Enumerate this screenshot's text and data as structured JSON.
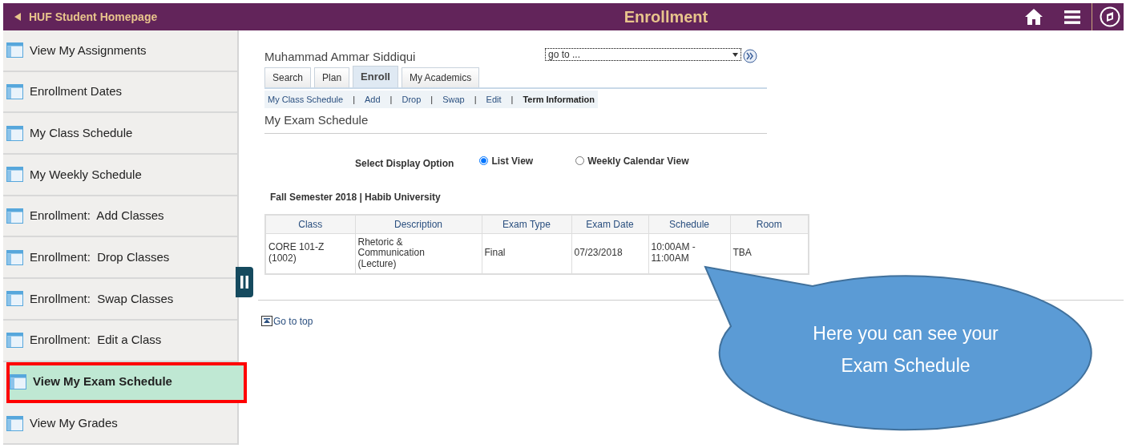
{
  "header": {
    "back_link": "HUF Student Homepage",
    "title": "Enrollment"
  },
  "sidebar": {
    "items": [
      {
        "label": "View My Assignments",
        "selected": false,
        "annotated": false
      },
      {
        "label": "Enrollment Dates",
        "selected": false,
        "annotated": false
      },
      {
        "label": "My Class Schedule",
        "selected": false,
        "annotated": false
      },
      {
        "label": "My Weekly Schedule",
        "selected": false,
        "annotated": false
      },
      {
        "label": "Enrollment:  Add Classes",
        "selected": false,
        "annotated": false
      },
      {
        "label": "Enrollment:  Drop Classes",
        "selected": false,
        "annotated": false
      },
      {
        "label": "Enrollment:  Swap Classes",
        "selected": false,
        "annotated": false
      },
      {
        "label": "Enrollment:  Edit a Class",
        "selected": false,
        "annotated": false
      },
      {
        "label": "View My Exam Schedule",
        "selected": true,
        "annotated": true
      },
      {
        "label": "View My Grades",
        "selected": false,
        "annotated": false
      }
    ]
  },
  "student_name": "Muhammad Ammar Siddiqui",
  "goto_select": {
    "value": "go to ..."
  },
  "tabs": [
    {
      "label": "Search",
      "selected": false
    },
    {
      "label": "Plan",
      "selected": false
    },
    {
      "label": "Enroll",
      "selected": true
    },
    {
      "label": "My Academics",
      "selected": false
    }
  ],
  "sub_link_separator": "|",
  "sub_links": [
    {
      "label": "My Class Schedule",
      "selected": false
    },
    {
      "label": "Add",
      "selected": false
    },
    {
      "label": "Drop",
      "selected": false
    },
    {
      "label": "Swap",
      "selected": false
    },
    {
      "label": "Edit",
      "selected": false
    },
    {
      "label": "Term Information",
      "selected": true
    }
  ],
  "page_title": "My Exam Schedule",
  "display_option": {
    "label": "Select Display Option",
    "options": [
      {
        "label": "List View",
        "selected": true
      },
      {
        "label": "Weekly Calendar View",
        "selected": false
      }
    ]
  },
  "term": "Fall Semester 2018 | Habib University",
  "table": {
    "columns": [
      "Class",
      "Description",
      "Exam Type",
      "Exam Date",
      "Schedule",
      "Room"
    ],
    "rows": [
      [
        "CORE 101-Z (1002)",
        "Rhetoric & Communication (Lecture)",
        "Final",
        "07/23/2018",
        "10:00AM - 11:00AM",
        "TBA"
      ]
    ]
  },
  "go_to_top": "Go to top",
  "callout": "Here you can see your Exam Schedule"
}
